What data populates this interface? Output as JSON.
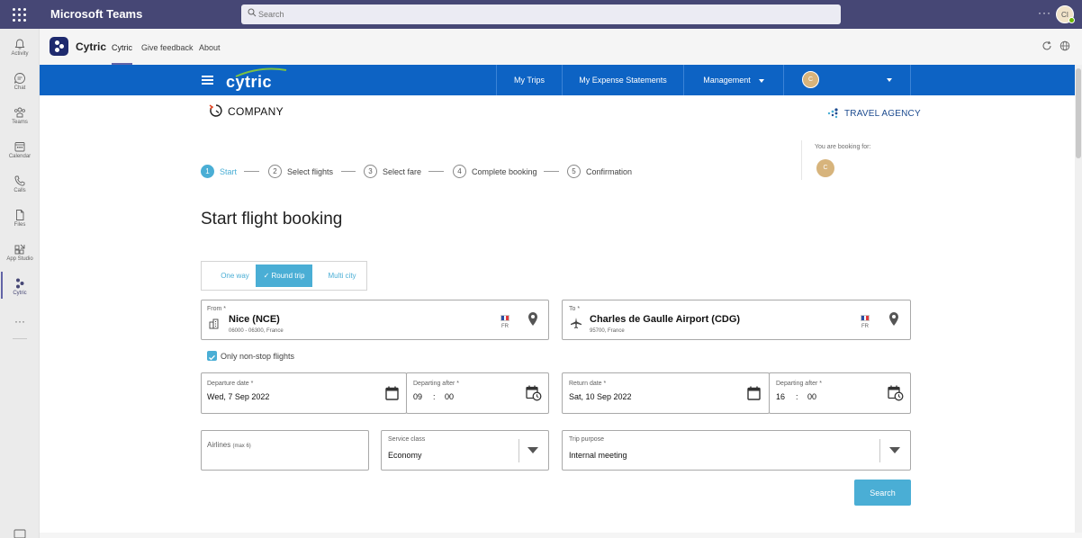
{
  "teams": {
    "app_title": "Microsoft Teams",
    "search_placeholder": "Search",
    "more": "···",
    "user_initials": "CI"
  },
  "rail": {
    "items": [
      {
        "label": "Activity",
        "icon": "bell-icon"
      },
      {
        "label": "Chat",
        "icon": "chat-icon"
      },
      {
        "label": "Teams",
        "icon": "teams-icon"
      },
      {
        "label": "Calendar",
        "icon": "calendar-icon"
      },
      {
        "label": "Calls",
        "icon": "phone-icon"
      },
      {
        "label": "Files",
        "icon": "file-icon"
      },
      {
        "label": "App Studio",
        "icon": "app-studio-icon"
      },
      {
        "label": "Cytric",
        "icon": "cytric-icon",
        "active": true
      }
    ],
    "more": "···"
  },
  "app_header": {
    "name": "Cytric",
    "tabs": [
      {
        "label": "Cytric",
        "active": true
      },
      {
        "label": "Give feedback"
      },
      {
        "label": "About"
      }
    ]
  },
  "cytric_nav": {
    "logo": "cytric",
    "items": {
      "my_trips": "My Trips",
      "my_expense": "My Expense Statements",
      "management": "Management"
    },
    "profile_initial": "C"
  },
  "branding": {
    "company": "COMPANY",
    "agency": "TRAVEL AGENCY"
  },
  "booking_for": {
    "label": "You are booking for:",
    "initial": "C"
  },
  "stepper": {
    "steps": [
      {
        "num": "1",
        "label": "Start",
        "active": true
      },
      {
        "num": "2",
        "label": "Select flights"
      },
      {
        "num": "3",
        "label": "Select fare"
      },
      {
        "num": "4",
        "label": "Complete booking"
      },
      {
        "num": "5",
        "label": "Confirmation"
      }
    ]
  },
  "page_title": "Start flight booking",
  "trip_type": {
    "options": [
      "One way",
      "Round trip",
      "Multi city"
    ],
    "selected": "Round trip"
  },
  "from": {
    "label": "From *",
    "value": "Nice (NCE)",
    "sub": "06000 - 06300, France",
    "country": "FR"
  },
  "to": {
    "label": "To *",
    "value": "Charles de Gaulle Airport (CDG)",
    "sub": "95700, France",
    "country": "FR"
  },
  "nonstop": {
    "label": "Only non-stop flights",
    "checked": true
  },
  "departure": {
    "date_label": "Departure date *",
    "date_value": "Wed, 7 Sep 2022",
    "time_label": "Departing after *",
    "hour": "09",
    "minute": "00"
  },
  "return": {
    "date_label": "Return date *",
    "date_value": "Sat, 10 Sep 2022",
    "time_label": "Departing after *",
    "hour": "16",
    "minute": "00"
  },
  "airlines": {
    "label": "Airlines",
    "hint": "(max 6)"
  },
  "service_class": {
    "label": "Service class",
    "value": "Economy"
  },
  "trip_purpose": {
    "label": "Trip purpose",
    "value": "Internal meeting"
  },
  "search_button": "Search",
  "colors": {
    "teams_purple": "#464775",
    "cytric_blue": "#0d63c4",
    "accent_teal": "#4aaed5"
  }
}
